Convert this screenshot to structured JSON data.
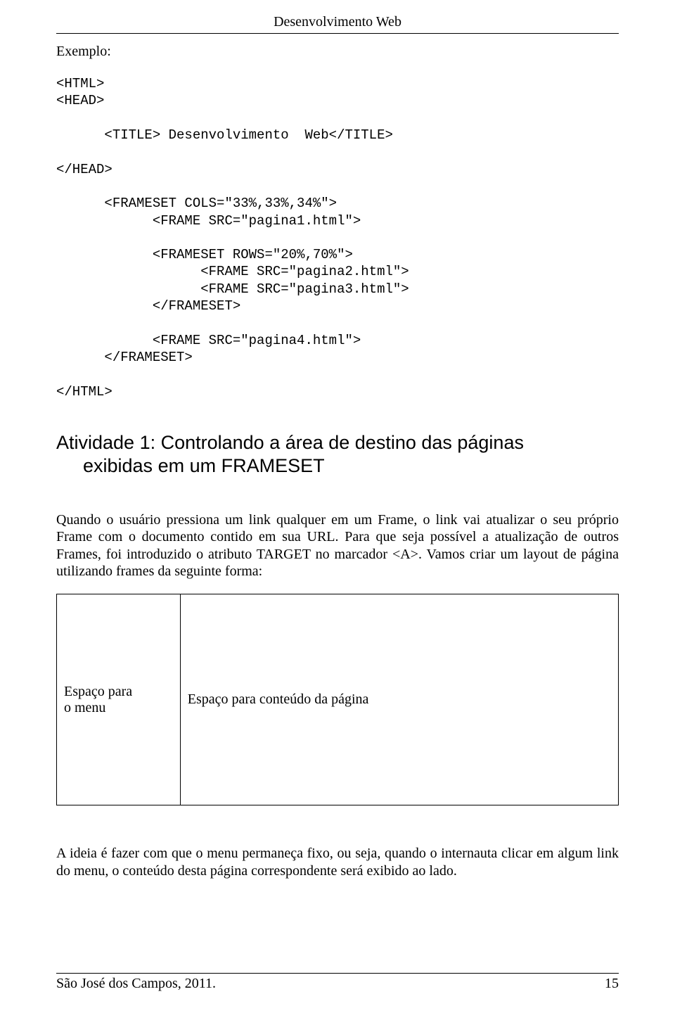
{
  "header": {
    "title": "Desenvolvimento Web"
  },
  "exemplo_label": "Exemplo:",
  "code_block": "<HTML>\n<HEAD>\n\n      <TITLE> Desenvolvimento  Web</TITLE>\n\n</HEAD>\n\n      <FRAMESET COLS=\"33%,33%,34%\">\n            <FRAME SRC=\"pagina1.html\">\n\n            <FRAMESET ROWS=\"20%,70%\">\n                  <FRAME SRC=\"pagina2.html\">\n                  <FRAME SRC=\"pagina3.html\">\n            </FRAMESET>\n\n            <FRAME SRC=\"pagina4.html\">\n      </FRAMESET>\n\n</HTML>",
  "heading": {
    "line1": "Atividade 1: Controlando a área de destino das páginas",
    "line2": "exibidas em um FRAMESET"
  },
  "para1": "Quando o usuário pressiona um link qualquer em um Frame, o link vai atualizar o seu próprio Frame com o documento contido em sua URL. Para que seja possível a atualização de outros Frames, foi introduzido o atributo TARGET no marcador <A>. Vamos criar um layout de página utilizando frames da seguinte forma:",
  "table": {
    "menu_line1": "Espaço para",
    "menu_line2": "o menu",
    "content": "Espaço para conteúdo da página"
  },
  "para2": "A ideia é fazer com que o menu permaneça fixo, ou seja, quando o internauta clicar em algum link do menu, o conteúdo desta página correspondente será exibido ao lado.",
  "footer": {
    "left": "São José dos Campos, 2011.",
    "right": "15"
  }
}
